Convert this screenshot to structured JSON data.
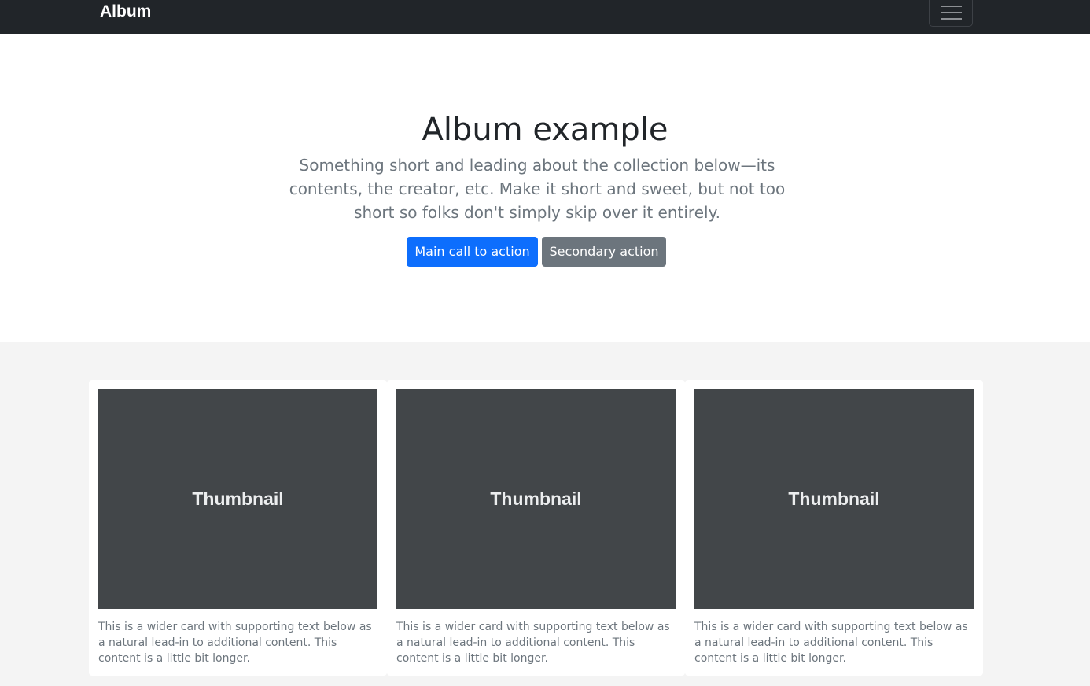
{
  "navbar": {
    "brand": "Album",
    "toggler_icon": "hamburger-menu-icon",
    "background": "#212529"
  },
  "hero": {
    "title": "Album example",
    "lead": "Something short and leading about the collection below—its contents, the creator, etc. Make it short and sweet, but not too short so folks don't simply skip over it entirely.",
    "primary_button": "Main call to action",
    "secondary_button": "Secondary action",
    "primary_color": "#0d6efd",
    "secondary_color": "#6c757d"
  },
  "album": {
    "background": "#f4f4f4",
    "cards": [
      {
        "thumbnail_label": "Thumbnail",
        "text": "This is a wider card with supporting text below as a natural lead-in to additional content. This content is a little bit longer."
      },
      {
        "thumbnail_label": "Thumbnail",
        "text": "This is a wider card with supporting text below as a natural lead-in to additional content. This content is a little bit longer."
      },
      {
        "thumbnail_label": "Thumbnail",
        "text": "This is a wider card with supporting text below as a natural lead-in to additional content. This content is a little bit longer."
      }
    ]
  }
}
